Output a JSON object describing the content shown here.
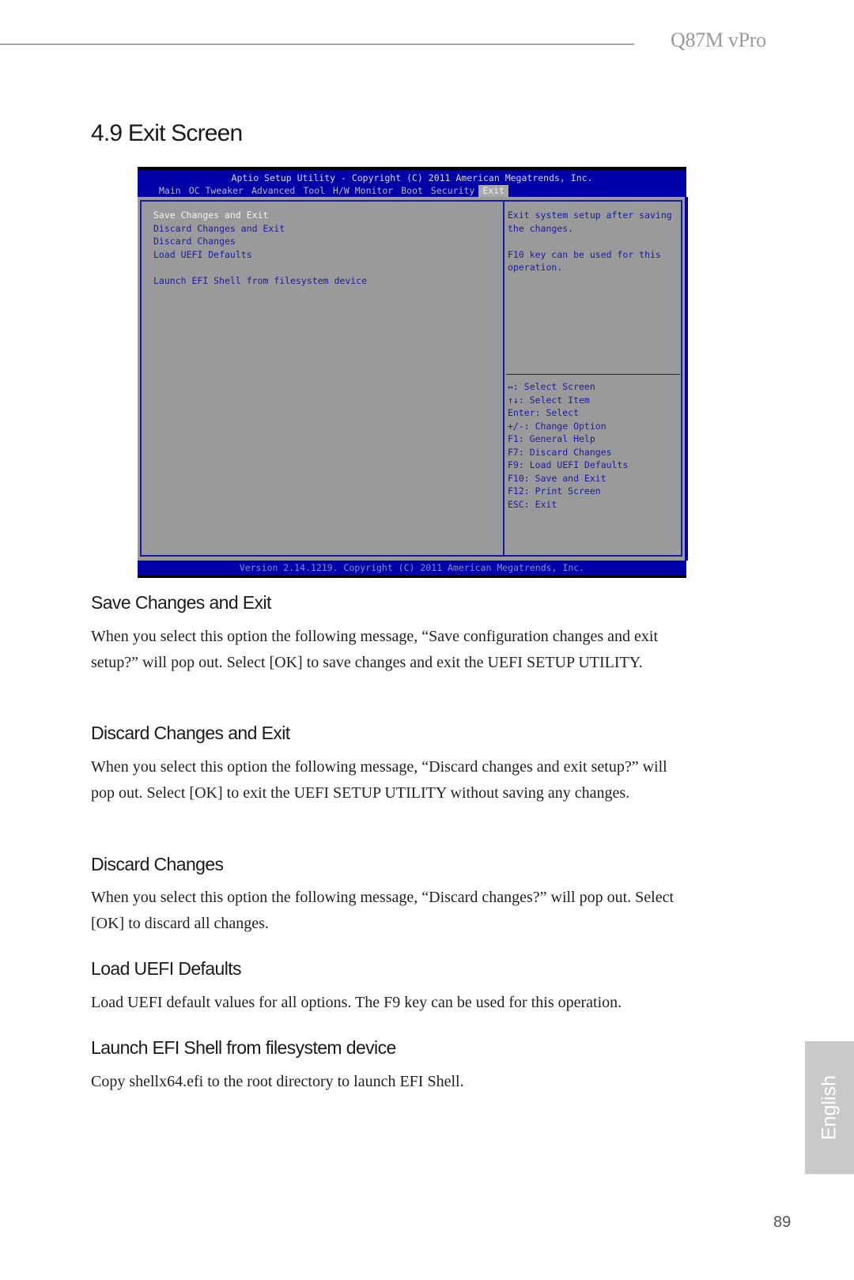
{
  "header": {
    "product": "Q87M vPro"
  },
  "section": {
    "title": "4.9  Exit Screen"
  },
  "bios": {
    "title": "Aptio Setup Utility - Copyright (C) 2011 American Megatrends, Inc.",
    "tabs": [
      {
        "label": "Main",
        "active": false
      },
      {
        "label": "OC Tweaker",
        "active": false
      },
      {
        "label": "Advanced",
        "active": false
      },
      {
        "label": "Tool",
        "active": false
      },
      {
        "label": "H/W Monitor",
        "active": false
      },
      {
        "label": "Boot",
        "active": false
      },
      {
        "label": "Security",
        "active": false
      },
      {
        "label": "Exit",
        "active": true
      }
    ],
    "menu": [
      {
        "label": "Save Changes and Exit",
        "selected": true
      },
      {
        "label": "Discard Changes and Exit",
        "selected": false
      },
      {
        "label": "Discard Changes",
        "selected": false
      },
      {
        "label": "Load UEFI Defaults",
        "selected": false
      },
      {
        "label": "Launch EFI Shell from filesystem device",
        "selected": false
      }
    ],
    "help": {
      "line1": "Exit system setup after saving",
      "line2": "the changes.",
      "line3": "F10 key can be used for this",
      "line4": "operation."
    },
    "keys": [
      "↔: Select Screen",
      "↑↓: Select Item",
      "Enter: Select",
      "+/-: Change Option",
      "F1: General Help",
      "F7: Discard Changes",
      "F9: Load UEFI Defaults",
      "F10: Save and Exit",
      "F12: Print Screen",
      "ESC: Exit"
    ],
    "version": "Version 2.14.1219. Copyright (C) 2011 American Megatrends, Inc."
  },
  "content": [
    {
      "heading": "Save Changes and Exit",
      "body": "When you select this option the following message, “Save configuration changes and exit setup?” will pop out. Select [OK] to save changes and exit the UEFI SETUP UTILITY."
    },
    {
      "heading": "Discard Changes and Exit",
      "body": "When you select this option the following message, “Discard changes and exit setup?” will pop out. Select [OK] to exit the UEFI SETUP UTILITY without saving any changes."
    },
    {
      "heading": "Discard Changes",
      "body": "When you select this option the following message, “Discard changes?” will pop out. Select [OK] to discard all changes."
    },
    {
      "heading": "Load UEFI Defaults",
      "body": "Load UEFI default values for all options. The F9 key can be used for this operation."
    },
    {
      "heading": "Launch EFI Shell from filesystem device",
      "body": "Copy shellx64.efi to the root directory to launch EFI Shell."
    }
  ],
  "sidebar": {
    "language": "English"
  },
  "footer": {
    "page_number": "89"
  }
}
